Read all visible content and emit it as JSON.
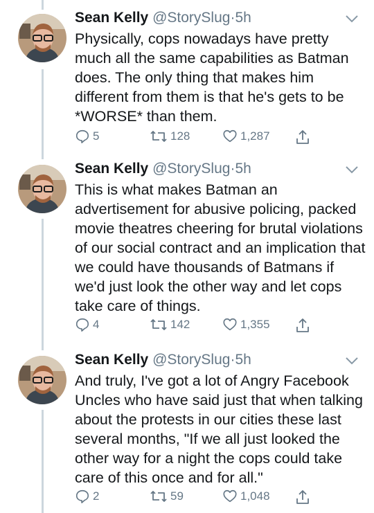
{
  "tweets": [
    {
      "name": "Sean Kelly",
      "handle": "@StorySlug",
      "separator": "·",
      "time": "5h",
      "text": "Physically, cops nowadays have pretty much all the same capabilities as Batman does. The only thing that makes him different from them is that he's gets to be *WORSE* than them.",
      "replies": "5",
      "retweets": "128",
      "likes": "1,287"
    },
    {
      "name": "Sean Kelly",
      "handle": "@StorySlug",
      "separator": "·",
      "time": "5h",
      "text": "This is what makes Batman an advertisement for abusive policing, packed movie theatres cheering for brutal violations of our social contract and an implication that we could have thousands of Batmans if we'd just look the other way and let cops take care of things.",
      "replies": "4",
      "retweets": "142",
      "likes": "1,355"
    },
    {
      "name": "Sean Kelly",
      "handle": "@StorySlug",
      "separator": "·",
      "time": "5h",
      "text": "And truly, I've got a lot of Angry Facebook Uncles who have said just that when talking about the protests in our cities these last several months, \"If we all just looked the other way for a night the cops could take care of this once and for all.\"",
      "replies": "2",
      "retweets": "59",
      "likes": "1,048"
    }
  ],
  "icons": {
    "reply": "reply-icon",
    "retweet": "retweet-icon",
    "like": "heart-icon",
    "share": "share-icon",
    "menu": "chevron-down-icon"
  },
  "colors": {
    "text": "#14171a",
    "secondary": "#657786",
    "thread_line": "#ccd6dd"
  }
}
